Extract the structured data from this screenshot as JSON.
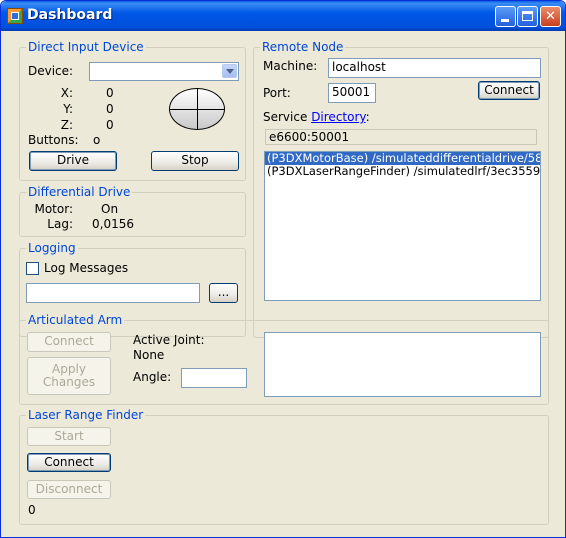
{
  "window": {
    "title": "Dashboard"
  },
  "direct_input": {
    "group_title": "Direct Input Device",
    "device_label": "Device:",
    "device_value": "",
    "x_label": "X:",
    "x_value": "0",
    "y_label": "Y:",
    "y_value": "0",
    "z_label": "Z:",
    "z_value": "0",
    "buttons_label": "Buttons:",
    "buttons_value": "o",
    "drive_button": "Drive",
    "stop_button": "Stop"
  },
  "differential_drive": {
    "group_title": "Differential Drive",
    "motor_label": "Motor:",
    "motor_value": "On",
    "lag_label": "Lag:",
    "lag_value": "0,0156"
  },
  "logging": {
    "group_title": "Logging",
    "log_messages_label": "Log Messages",
    "log_messages_checked": false,
    "file_value": "",
    "browse_button": "..."
  },
  "remote_node": {
    "group_title": "Remote Node",
    "machine_label": "Machine:",
    "machine_value": "localhost",
    "port_label": "Port:",
    "port_value": "50001",
    "connect_button": "Connect",
    "service_label": "Service",
    "directory_link": "Directory",
    "colon": ":",
    "service_value": "e6600:50001",
    "services": [
      "(P3DXMotorBase) /simulateddifferentialdrive/58",
      "(P3DXLaserRangeFinder) /simulatedlrf/3ec3559"
    ],
    "selected_index": 0
  },
  "articulated_arm": {
    "group_title": "Articulated Arm",
    "connect_button": "Connect",
    "apply_line1": "Apply",
    "apply_line2": "Changes",
    "active_joint_label": "Active Joint:",
    "active_joint_value": "None",
    "angle_label": "Angle:",
    "angle_value": ""
  },
  "laser_range_finder": {
    "group_title": "Laser Range Finder",
    "start_button": "Start",
    "connect_button": "Connect",
    "disconnect_button": "Disconnect",
    "status_value": "0"
  }
}
